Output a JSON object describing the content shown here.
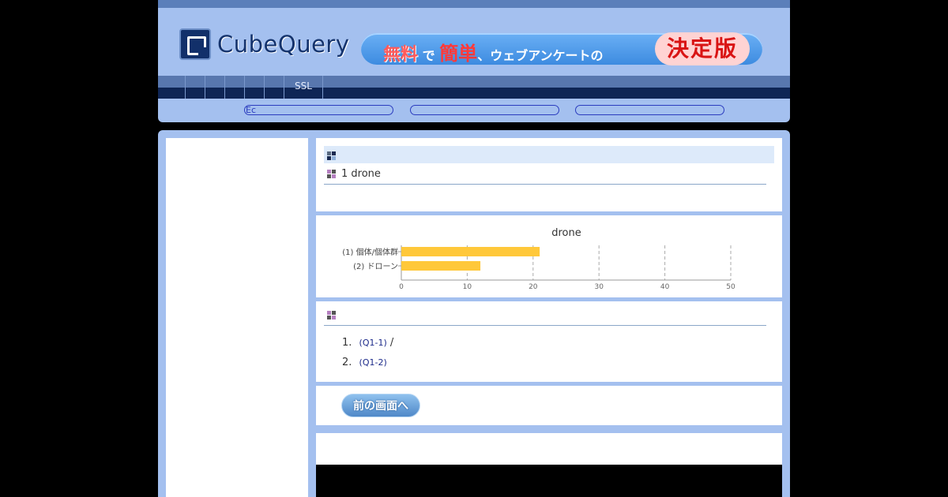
{
  "header": {
    "logo_text": "CubeQuery",
    "banner": {
      "part1": "無料",
      "part2": "で",
      "part3": "簡単",
      "part4": "、ウェブアンケートの",
      "badge": "決定版"
    }
  },
  "nav": {
    "items": [
      "",
      "",
      "",
      "",
      "",
      "",
      "SSL"
    ]
  },
  "subbar": {
    "pills": [
      "Ec",
      "",
      ""
    ]
  },
  "question": {
    "title": "1 drone"
  },
  "chart_data": {
    "type": "bar",
    "orientation": "horizontal",
    "title": "drone",
    "categories": [
      "(1) 個体/個体群",
      "(2) ドローン"
    ],
    "values": [
      21,
      12
    ],
    "xlim": [
      0,
      50
    ],
    "xticks": [
      0,
      10,
      20,
      30,
      40,
      50
    ],
    "grid": true,
    "color": "#ffc83a"
  },
  "answers": {
    "items": [
      {
        "num": "1.",
        "code": "(Q1-1)",
        "suffix": "/"
      },
      {
        "num": "2.",
        "code": "(Q1-2)",
        "suffix": ""
      }
    ]
  },
  "buttons": {
    "back_label": "前の画面へ"
  },
  "colors": {
    "frame_bg": "#a4c0ef",
    "nav_dark": "#0e2555",
    "accent": "#3d8be0"
  }
}
